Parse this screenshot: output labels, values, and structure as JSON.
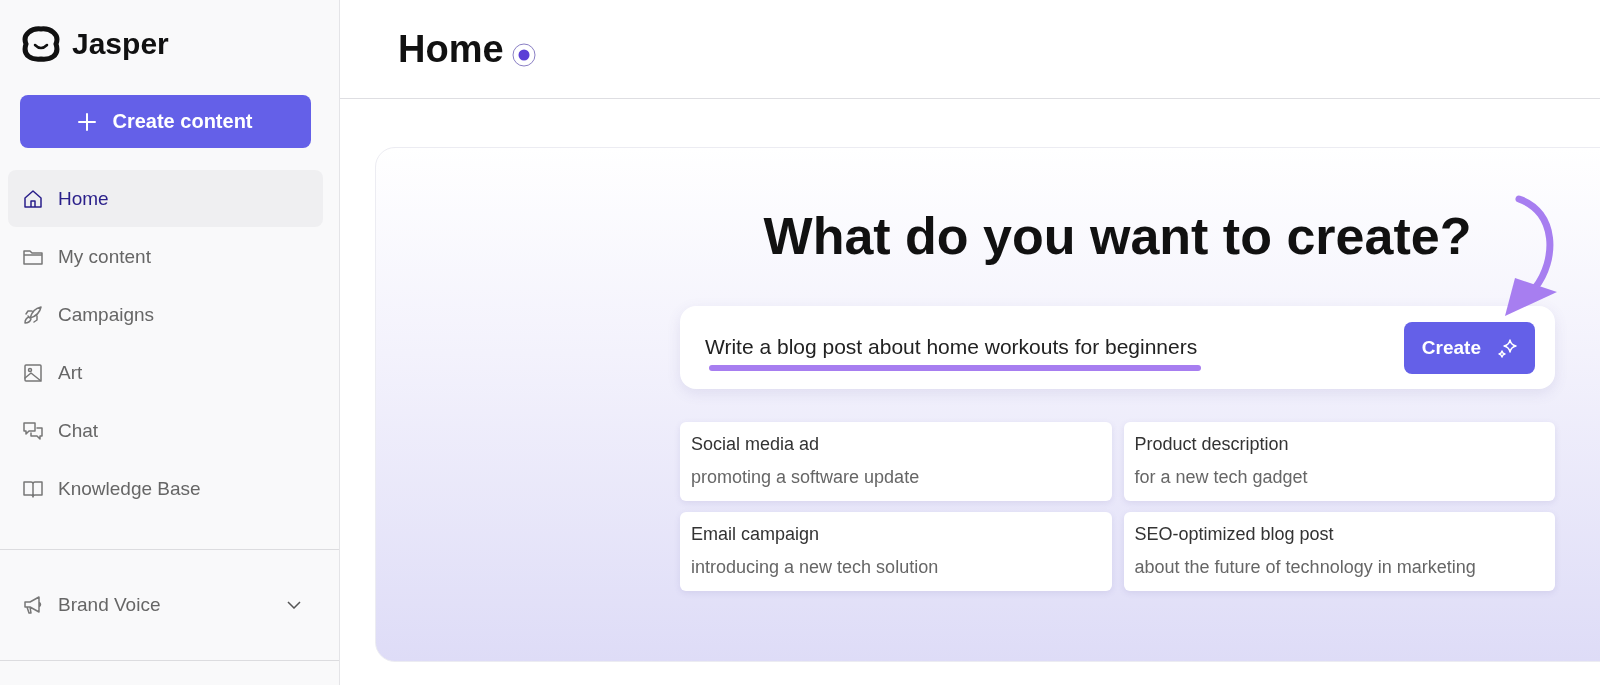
{
  "brand": {
    "name": "Jasper"
  },
  "create_button": "Create content",
  "nav": [
    {
      "label": "Home",
      "selected": true
    },
    {
      "label": "My content",
      "selected": false
    },
    {
      "label": "Campaigns",
      "selected": false
    },
    {
      "label": "Art",
      "selected": false
    },
    {
      "label": "Chat",
      "selected": false
    },
    {
      "label": "Knowledge Base",
      "selected": false
    }
  ],
  "brand_voice": {
    "label": "Brand Voice",
    "expanded": false
  },
  "page_title": "Home",
  "heading": "What do you want to create?",
  "prompt": {
    "value": "Write a blog post about home workouts for beginners",
    "button": "Create"
  },
  "suggestions": [
    {
      "title": "Social media ad",
      "subtitle": "promoting a software update"
    },
    {
      "title": "Product description",
      "subtitle": "for a new tech gadget"
    },
    {
      "title": "Email campaign",
      "subtitle": "introducing a new tech solution"
    },
    {
      "title": "SEO-optimized blog post",
      "subtitle": "about the future of technology in marketing"
    }
  ]
}
